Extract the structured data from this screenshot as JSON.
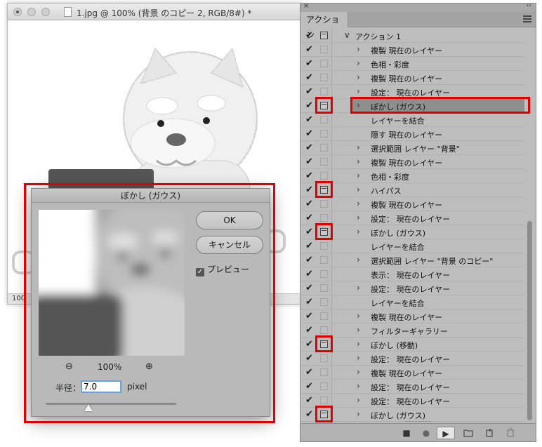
{
  "document": {
    "title": "1.jpg @ 100% (背景 のコピー 2, RGB/8#) *",
    "status_zoom": "100"
  },
  "panel": {
    "tab": "アクション",
    "close_glyph": "×",
    "collapse_glyph": "‹‹",
    "rows": [
      {
        "label": "アクション 1",
        "dialog": true,
        "level": 1,
        "chevron": "∨"
      },
      {
        "label": "複製  現在のレイヤー",
        "dialog": false,
        "chevron": "›"
      },
      {
        "label": "色相・彩度",
        "dialog": false,
        "chevron": "›"
      },
      {
        "label": "複製  現在のレイヤー",
        "dialog": false,
        "chevron": "›"
      },
      {
        "label": "設定：  現在のレイヤー",
        "dialog": false,
        "chevron": "›"
      },
      {
        "label": "ぼかし (ガウス)",
        "dialog": true,
        "chevron": "›",
        "selected": true
      },
      {
        "label": "レイヤーを結合",
        "dialog": false,
        "chevron": ""
      },
      {
        "label": "隠す  現在のレイヤー",
        "dialog": false,
        "chevron": ""
      },
      {
        "label": "選択範囲  レイヤー \"背景\"",
        "dialog": false,
        "chevron": "›"
      },
      {
        "label": "複製  現在のレイヤー",
        "dialog": false,
        "chevron": "›"
      },
      {
        "label": "色相・彩度",
        "dialog": false,
        "chevron": "›"
      },
      {
        "label": "ハイパス",
        "dialog": true,
        "chevron": "›"
      },
      {
        "label": "複製  現在のレイヤー",
        "dialog": false,
        "chevron": "›"
      },
      {
        "label": "設定：  現在のレイヤー",
        "dialog": false,
        "chevron": "›"
      },
      {
        "label": "ぼかし (ガウス)",
        "dialog": true,
        "chevron": "›"
      },
      {
        "label": "レイヤーを結合",
        "dialog": false,
        "chevron": ""
      },
      {
        "label": "選択範囲  レイヤー \"背景 のコピー\"",
        "dialog": false,
        "chevron": "›"
      },
      {
        "label": "表示：  現在のレイヤー",
        "dialog": false,
        "chevron": ""
      },
      {
        "label": "設定：  現在のレイヤー",
        "dialog": false,
        "chevron": "›"
      },
      {
        "label": "レイヤーを結合",
        "dialog": false,
        "chevron": ""
      },
      {
        "label": "複製  現在のレイヤー",
        "dialog": false,
        "chevron": "›"
      },
      {
        "label": "フィルターギャラリー",
        "dialog": false,
        "chevron": "›"
      },
      {
        "label": "ぼかし (移動)",
        "dialog": true,
        "chevron": "›"
      },
      {
        "label": "設定：  現在のレイヤー",
        "dialog": false,
        "chevron": "›"
      },
      {
        "label": "複製  現在のレイヤー",
        "dialog": false,
        "chevron": "›"
      },
      {
        "label": "設定：  現在のレイヤー",
        "dialog": false,
        "chevron": "›"
      },
      {
        "label": "設定：  現在のレイヤー",
        "dialog": false,
        "chevron": "›"
      },
      {
        "label": "ぼかし (ガウス)",
        "dialog": true,
        "chevron": "›"
      }
    ],
    "footer": {
      "stop": "■",
      "record": "●",
      "play": "▶"
    }
  },
  "dialog": {
    "title": "ぼかし (ガウス)",
    "ok_label": "OK",
    "cancel_label": "キャンセル",
    "preview_label": "プレビュー",
    "preview_checked": true,
    "zoom_out": "⊖",
    "zoom_in": "⊕",
    "zoom_value": "100%",
    "radius_label": "半径：",
    "radius_value": "7.0",
    "radius_unit": "pixel"
  },
  "colors": {
    "highlight": "#e00000",
    "input_focus": "#6aa0e0"
  }
}
